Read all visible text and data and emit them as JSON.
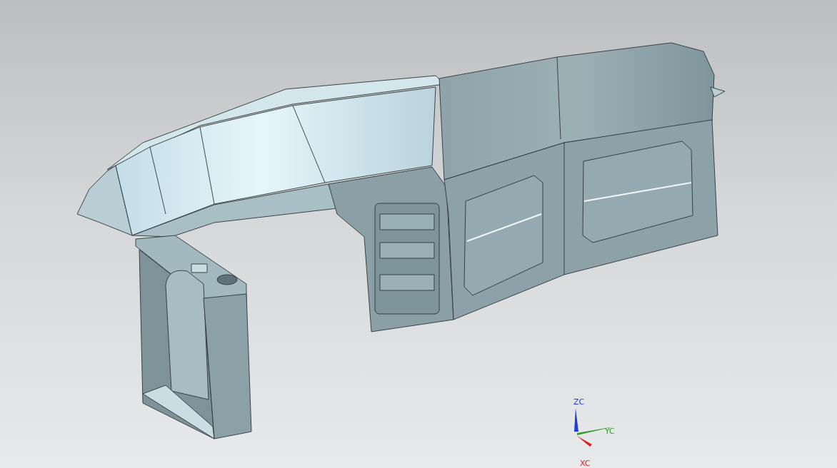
{
  "viewport": {
    "triad": [
      {
        "kind": "z",
        "label": "ZC",
        "color": "#1e3ed6"
      },
      {
        "kind": "y",
        "label": "YC",
        "color": "#2e9e2e"
      },
      {
        "kind": "x",
        "label": "XC",
        "color": "#d42424"
      }
    ]
  }
}
